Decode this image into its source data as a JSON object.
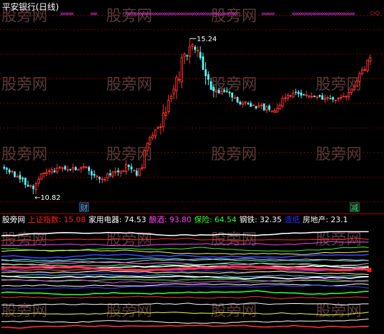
{
  "header": {
    "title": "平安银行(日线)",
    "title_color": "#ffffff"
  },
  "watermark": {
    "text": "股旁网",
    "color": "#5a3a3a"
  },
  "colors": {
    "background": "#000000",
    "up_candle": "#ff3232",
    "down_candle": "#54fcfc",
    "gridline": "#8b0000",
    "divider": "#b00000",
    "x_markers": "#ff3cff",
    "annotation": "#ffffff"
  },
  "chart_data": [
    {
      "type": "candlestick",
      "title": "平安银行(日线)",
      "ylim": [
        10.3,
        15.9
      ],
      "grid": true,
      "annotations": [
        {
          "label": "15.24",
          "x_index": 70,
          "y": 15.24,
          "kind": "high"
        },
        {
          "label": "10.82",
          "x_index": 11,
          "y": 10.82,
          "kind": "low"
        }
      ],
      "badges": [
        {
          "label": "财",
          "x_index": 30,
          "color": "#4aa0ff"
        },
        {
          "label": "减",
          "x_index": 132,
          "color": "#29e06a"
        }
      ],
      "top_markers": {
        "symbol": "×",
        "count": 96,
        "trailing": "◇◇"
      },
      "candles": []
    },
    {
      "type": "line",
      "title": "",
      "legend": [
        {
          "name": "股旁网",
          "value": "",
          "color": "#ffffff"
        },
        {
          "name": "上证指数",
          "value": "15.08",
          "color": "#ff2020"
        },
        {
          "name": "家用电器",
          "value": "74.53",
          "color": "#ffffff"
        },
        {
          "name": "酿酒",
          "value": "93.80",
          "color": "#ff40ff"
        },
        {
          "name": "保险",
          "value": "64.54",
          "color": "#30ff30"
        },
        {
          "name": "钢铁",
          "value": "32.35",
          "color": "#ffffff"
        },
        {
          "name": "造纸",
          "value": "",
          "color": "#3030ff"
        },
        {
          "name": "房地产",
          "value": "23.1",
          "color": "#ffffff"
        }
      ],
      "ylim": [
        0,
        100
      ],
      "series": []
    }
  ]
}
